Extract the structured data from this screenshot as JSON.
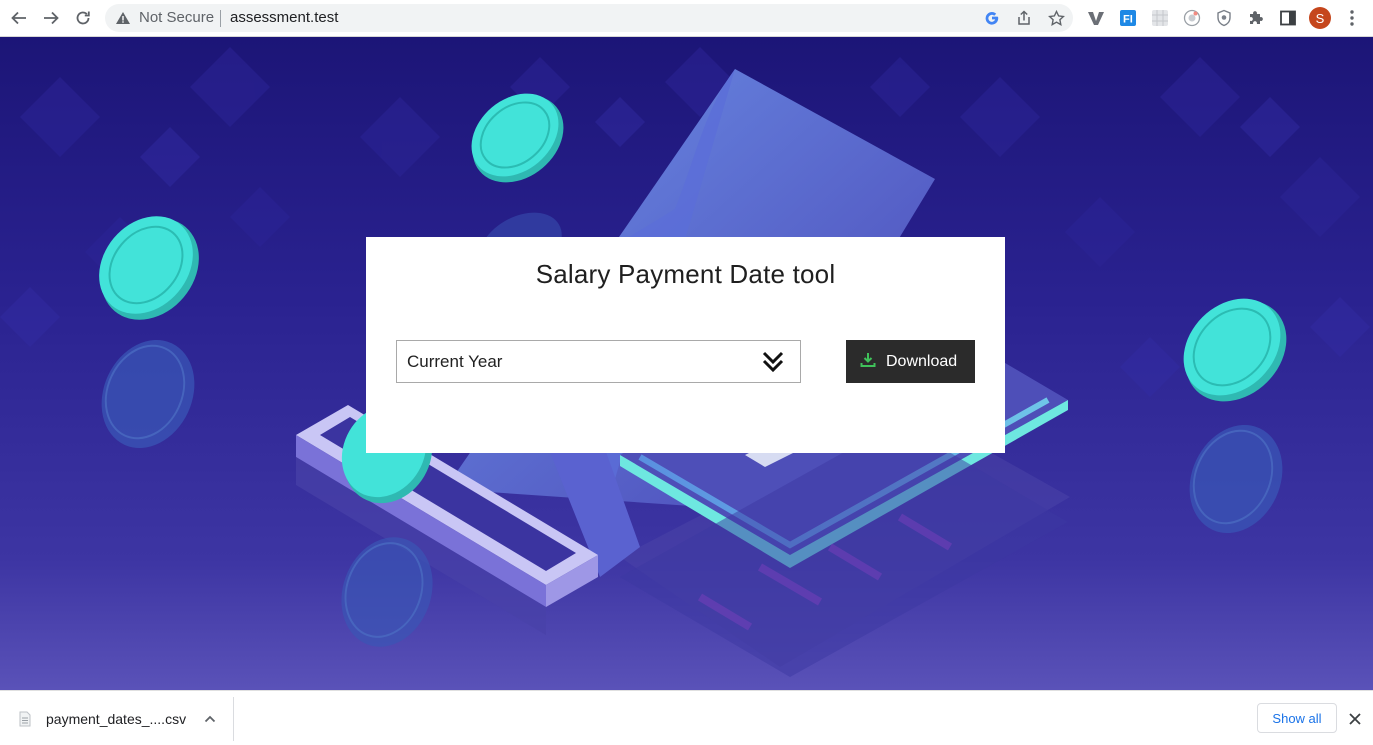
{
  "browser": {
    "security_label": "Not Secure",
    "url": "assessment.test",
    "avatar_letter": "S",
    "extension_icons": [
      "vimeo-style-icon",
      "fi-extension-icon",
      "grid-extension-icon",
      "record-extension-icon",
      "shield-extension-icon",
      "puzzle-icon",
      "side-panel-icon"
    ]
  },
  "page": {
    "title": "Salary Payment Date tool",
    "year_select": {
      "selected": "Current Year"
    },
    "download_button": {
      "label": "Download"
    },
    "colors": {
      "accent_green": "#3fc25a",
      "button_bg": "#2b2b2b",
      "bg_top": "#1c1577",
      "coin": "#3ee0d6"
    }
  },
  "downloads_shelf": {
    "file_name": "payment_dates_....csv",
    "show_all_label": "Show all"
  }
}
